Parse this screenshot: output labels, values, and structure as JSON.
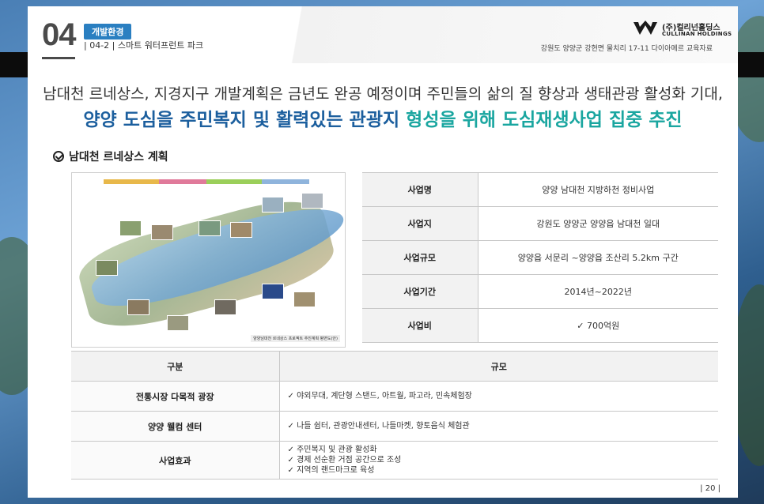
{
  "header": {
    "section_number": "04",
    "badge": "개발환경",
    "subtitle": "| 04-2 | 스마트 워터프런트 파크",
    "logo_ko": "(주)컬리넌홀딩스",
    "logo_en": "CULLINAN HOLDINGS",
    "address": "강원도 양양군 강현면 물치리 17-11 다이아메르 교육자료"
  },
  "headline": {
    "line1": "남대천 르네상스, 지경지구 개발계획은 금년도 완공 예정이며  주민들의 삶의 질 향상과 생태관광 활성화 기대,",
    "line2_a": "양양 도심을 주민복지 및 활력있는 관광지 ",
    "line2_b": "형성을 위해 도심재생사업 집중 추진"
  },
  "section": {
    "title": "남대천 르네상스 계획",
    "map_caption": "양양남대천 르네상스 프로젝트 추진계획 평면도(안)"
  },
  "info_table": [
    {
      "label": "사업명",
      "value": "양양 남대천 지방하천 정비사업"
    },
    {
      "label": "사업지",
      "value": "강원도 양양군 양양읍 남대천 일대"
    },
    {
      "label": "사업규모",
      "value": "양양읍 서문리 ~양양읍 조산리 5.2km 구간"
    },
    {
      "label": "사업기간",
      "value": "2014년~2022년"
    },
    {
      "label": "사업비",
      "value": "✓  700억원"
    }
  ],
  "main_table": {
    "headers": [
      "구분",
      "규모"
    ],
    "rows": [
      {
        "label": "전통시장 다목적 광장",
        "items": [
          "야외무대, 계단형 스탠드, 아트월, 파고라, 민속체험장"
        ]
      },
      {
        "label": "양양 웰컴 센터",
        "items": [
          "나들 쉼터, 관광안내센터, 나들마켓, 향토음식 체험관"
        ]
      },
      {
        "label": "사업효과",
        "items": [
          "주민복지 및 관광 활성화",
          "경제 선순환 거점 공간으로 조성",
          "지역의 랜드마크로 육성"
        ]
      }
    ]
  },
  "page_number": "| 20 |",
  "colors": {
    "accent_blue": "#1c5f9e",
    "accent_teal": "#1aa6a0",
    "badge": "#2a7fc1"
  }
}
